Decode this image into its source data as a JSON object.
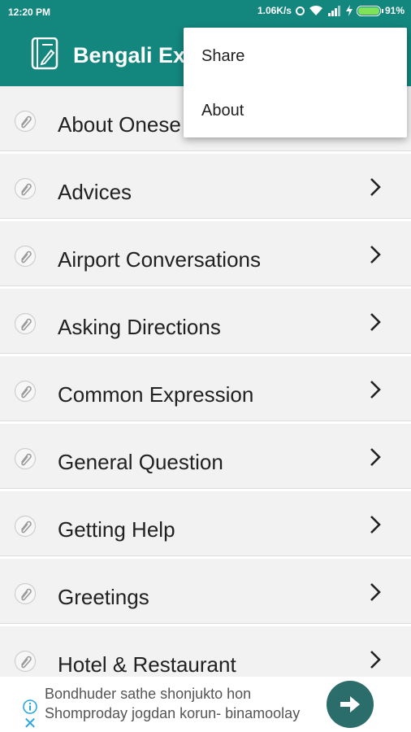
{
  "status": {
    "time": "12:20 PM",
    "network_speed": "1.06K/s",
    "battery_percent": "91%"
  },
  "app": {
    "title": "Bengali Exp"
  },
  "menu": {
    "items": [
      {
        "label": "Share"
      },
      {
        "label": "About"
      }
    ]
  },
  "list": {
    "items": [
      {
        "label": "About Onese",
        "has_chevron": false
      },
      {
        "label": "Advices",
        "has_chevron": true
      },
      {
        "label": "Airport Conversations",
        "has_chevron": true
      },
      {
        "label": "Asking Directions",
        "has_chevron": true
      },
      {
        "label": "Common Expression",
        "has_chevron": true
      },
      {
        "label": "General Question",
        "has_chevron": true
      },
      {
        "label": "Getting Help",
        "has_chevron": true
      },
      {
        "label": "Greetings",
        "has_chevron": true
      },
      {
        "label": "Hotel & Restaurant",
        "has_chevron": true
      }
    ]
  },
  "ad": {
    "line1": "Bondhuder sathe shonjukto hon",
    "line2": "Shomproday jogdan korun- binamoolay",
    "close_label": "✕"
  },
  "colors": {
    "primary": "#13877e",
    "list_bg": "#f2f2f2",
    "ad_button": "#2b6d6b"
  }
}
